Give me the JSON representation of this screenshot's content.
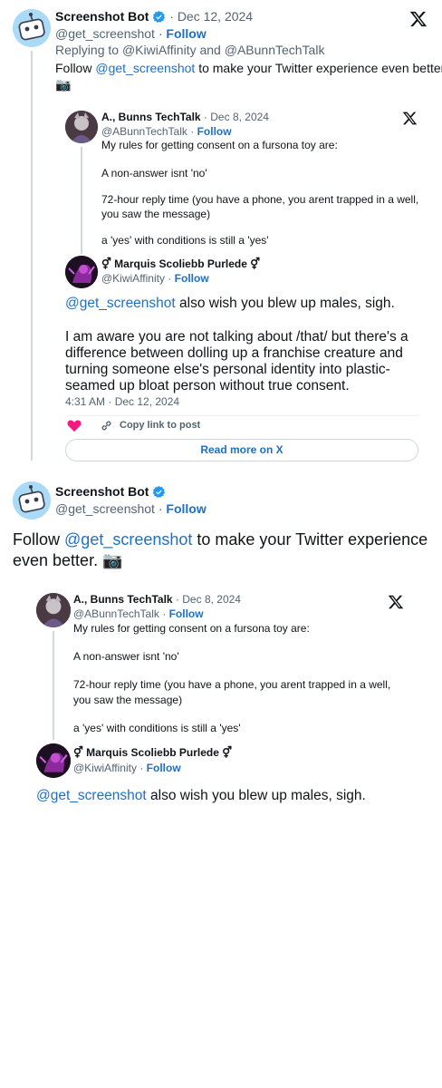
{
  "first_tweet": {
    "name": "Screenshot Bot",
    "dot": "·",
    "date": "Dec 12, 2024",
    "handle": "@get_screenshot",
    "follow": "Follow",
    "replying_prefix": "Replying to",
    "reply_user_1": "@KiwiAffinity",
    "reply_and": "and",
    "reply_user_2": "@ABunnTechTalk",
    "text_pre": "Follow",
    "text_mention": "@get_screenshot",
    "text_post": "to make your Twitter experience even better.",
    "emoji": "📷"
  },
  "quoted_a": {
    "name": "A., Bunns TechTalk",
    "date": "Dec 8, 2024",
    "handle": "@ABunnTechTalk",
    "follow": "Follow",
    "lines": [
      "My rules for getting consent on a fursona toy are:",
      "A non-answer isnt 'no'",
      "72-hour reply time (you have a phone, you arent trapped in a well,",
      "you saw the message)",
      "a 'yes' with conditions is still a 'yes'"
    ]
  },
  "quoted_b": {
    "name": "⚥ Marquis Scoliebb Purlede ⚥",
    "handle": "@KiwiAffinity",
    "follow": "Follow",
    "mention": "@get_screenshot",
    "first_line_rest": "also wish you blew up males, sigh.",
    "para_lines": [
      "I am aware you are not talking about /that/ but there's a",
      "difference between dolling up a franchise creature and",
      "turning someone else's personal identity into plastic-",
      "seamed up bloat person without true consent."
    ],
    "timestamp": "4:31 AM · Dec 12, 2024",
    "copy_link": "Copy link to post",
    "read_more": "Read more on X"
  },
  "second_tweet": {
    "name": "Screenshot Bot",
    "handle": "@get_screenshot",
    "follow": "Follow",
    "text_pre": "Follow",
    "text_mention": "@get_screenshot",
    "text_post_1": "to make your Twitter experience",
    "text_post_2": "even better.",
    "emoji": "📷"
  },
  "quoted_a2": {
    "name": "A., Bunns TechTalk",
    "date": "Dec 8, 2024",
    "handle": "@ABunnTechTalk",
    "follow": "Follow",
    "lines": [
      "My rules for getting consent on a fursona toy are:",
      "A non-answer isnt 'no'",
      "72-hour reply time (you have a phone, you arent trapped in a well,",
      "you saw the message)",
      "a 'yes' with conditions is still a 'yes'"
    ]
  },
  "quoted_b2": {
    "name": "⚥ Marquis Scoliebb Purlede ⚥",
    "handle": "@KiwiAffinity",
    "follow": "Follow",
    "mention": "@get_screenshot",
    "first_line_rest": "also wish you blew up males, sigh."
  },
  "colors": {
    "link": "#1d70c6",
    "verified": "#1d9bf0",
    "heart": "#f91880",
    "muted": "#536471"
  },
  "icons": [
    "robot-avatar-icon",
    "verified-badge-icon",
    "x-logo-icon",
    "heart-icon",
    "link-icon"
  ]
}
